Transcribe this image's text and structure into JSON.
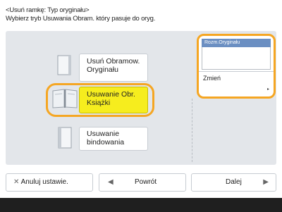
{
  "header": {
    "line1": "<Usuń ramkę: Typ oryginału>",
    "line2": "Wybierz tryb Usuwania Obram. który pasuje do oryg."
  },
  "options": [
    {
      "label_line1": "Usuń Obramow.",
      "label_line2": "Oryginału",
      "selected": false,
      "icon": "single-sheet-icon"
    },
    {
      "label_line1": "Usuwanie Obr.",
      "label_line2": "Książki",
      "selected": true,
      "icon": "open-book-icon"
    },
    {
      "label_line1": "Usuwanie",
      "label_line2": "bindowania",
      "selected": false,
      "icon": "bound-sheet-icon"
    }
  ],
  "side_panel": {
    "title": "Rozm.Oryginału",
    "value": "",
    "change_label": "Zmień"
  },
  "footer": {
    "cancel_label": "Anuluj ustawie.",
    "back_label": "Powrót",
    "next_label": "Dalej"
  },
  "colors": {
    "panel_bg": "#e3e6ea",
    "selected_bg": "#f6ed1e",
    "highlight_ring": "#f5a623",
    "title_bar": "#6b8fc2"
  }
}
